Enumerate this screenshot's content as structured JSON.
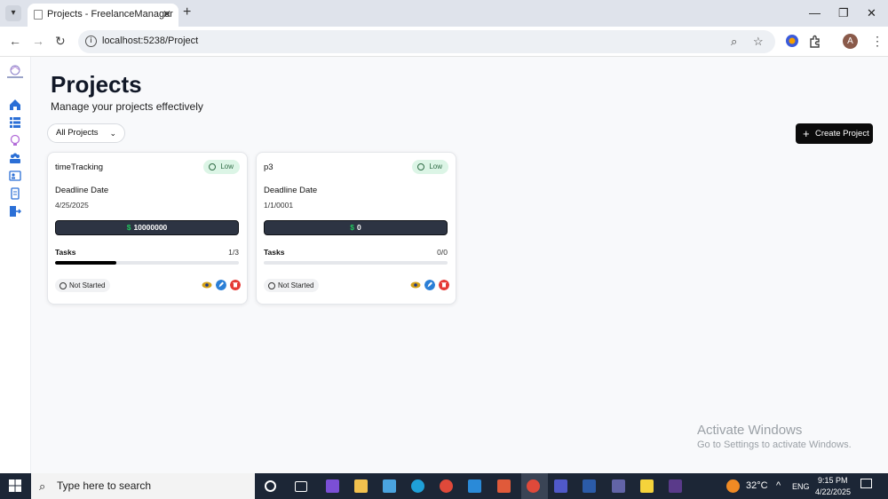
{
  "browser": {
    "tab_title": "Projects - FreelanceManager",
    "tab_close": "✕",
    "new_tab": "+",
    "url": "localhost:5238/Project",
    "window_controls": {
      "minimize": "—",
      "maximize": "❐",
      "close": "✕"
    },
    "profile_initial": "A"
  },
  "page": {
    "title": "Projects",
    "subtitle": "Manage your projects effectively",
    "filter": {
      "selected": "All Projects"
    },
    "create_button": "Create Project"
  },
  "projects": [
    {
      "name": "timeTracking",
      "priority": "Low",
      "deadline_label": "Deadline Date",
      "deadline": "4/25/2025",
      "budget": "10000000",
      "tasks_label": "Tasks",
      "tasks_count": "1/3",
      "progress": 0.333,
      "status": "Not Started"
    },
    {
      "name": "p3",
      "priority": "Low",
      "deadline_label": "Deadline Date",
      "deadline": "1/1/0001",
      "budget": "0",
      "tasks_label": "Tasks",
      "tasks_count": "0/0",
      "progress": 0,
      "status": "Not Started"
    }
  ],
  "colors": {
    "priority_low_bg": "#dcf5e6",
    "budget_bg": "#2d3443",
    "dollar": "#22c55e",
    "view_icon": "#d4a017",
    "edit_icon": "#2b7fd6",
    "delete_icon": "#e53935",
    "sidebar_icon": "#2b6fd6"
  },
  "sidebar": [
    "home-icon",
    "list-icon",
    "bulb-icon",
    "team-icon",
    "clients-icon",
    "document-icon",
    "logout-icon"
  ],
  "watermark": {
    "line1": "Activate Windows",
    "line2": "Go to Settings to activate Windows."
  },
  "taskbar": {
    "search_placeholder": "Type here to search",
    "temperature": "32°C",
    "language": "ENG",
    "time": "9:15 PM",
    "date": "4/22/2025"
  }
}
